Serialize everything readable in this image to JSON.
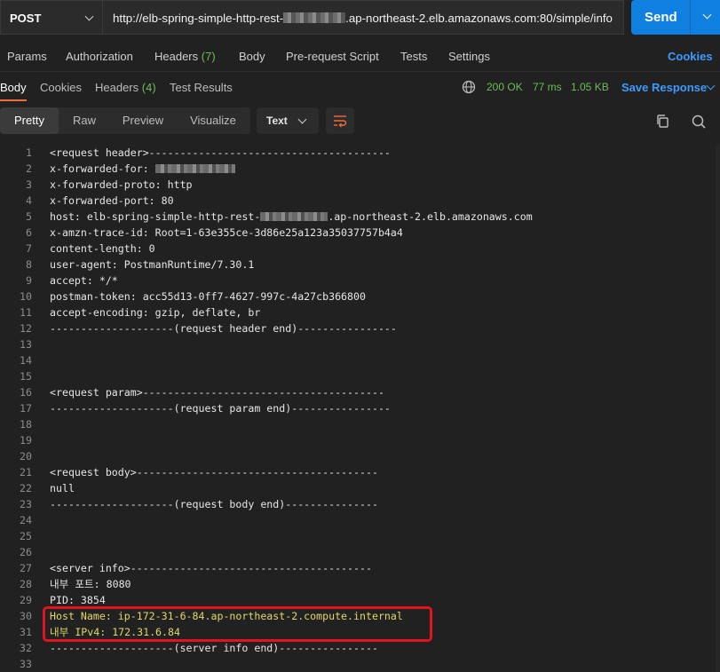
{
  "request": {
    "method": "POST",
    "url_prefix": "http://elb-spring-simple-http-rest-",
    "url_suffix": ".ap-northeast-2.elb.amazonaws.com:80/simple/info",
    "send_label": "Send"
  },
  "request_tabs": [
    {
      "label": "Params"
    },
    {
      "label": "Authorization"
    },
    {
      "label": "Headers",
      "count": "(7)"
    },
    {
      "label": "Body"
    },
    {
      "label": "Pre-request Script"
    },
    {
      "label": "Tests"
    },
    {
      "label": "Settings"
    }
  ],
  "cookies_link": "Cookies",
  "response_tabs": [
    {
      "label": "Body"
    },
    {
      "label": "Cookies"
    },
    {
      "label": "Headers",
      "count": "(4)"
    },
    {
      "label": "Test Results"
    }
  ],
  "status": {
    "code": "200 OK",
    "time": "77 ms",
    "size": "1.05 KB"
  },
  "save_response_label": "Save Response",
  "view_modes": [
    "Pretty",
    "Raw",
    "Preview",
    "Visualize"
  ],
  "active_view": "Pretty",
  "format_label": "Text",
  "code_lines": [
    {
      "n": "1",
      "text": "<request header>---------------------------------------"
    },
    {
      "n": "2",
      "text": "x-forwarded-for: "
    },
    {
      "n": "3",
      "text": "x-forwarded-proto: http"
    },
    {
      "n": "4",
      "text": "x-forwarded-port: 80"
    },
    {
      "n": "5",
      "text": "host: elb-spring-simple-http-rest-",
      "text2": ".ap-northeast-2.elb.amazonaws.com"
    },
    {
      "n": "6",
      "text": "x-amzn-trace-id: Root=1-63e355ce-3d86e25a123a35037757b4a4"
    },
    {
      "n": "7",
      "text": "content-length: 0"
    },
    {
      "n": "8",
      "text": "user-agent: PostmanRuntime/7.30.1"
    },
    {
      "n": "9",
      "text": "accept: */*"
    },
    {
      "n": "10",
      "text": "postman-token: acc55d13-0ff7-4627-997c-4a27cb366800"
    },
    {
      "n": "11",
      "text": "accept-encoding: gzip, deflate, br"
    },
    {
      "n": "12",
      "text": "--------------------(request header end)----------------"
    },
    {
      "n": "13",
      "text": ""
    },
    {
      "n": "14",
      "text": ""
    },
    {
      "n": "15",
      "text": ""
    },
    {
      "n": "16",
      "text": "<request param>---------------------------------------"
    },
    {
      "n": "17",
      "text": "--------------------(request param end)----------------"
    },
    {
      "n": "18",
      "text": ""
    },
    {
      "n": "19",
      "text": ""
    },
    {
      "n": "20",
      "text": ""
    },
    {
      "n": "21",
      "text": "<request body>---------------------------------------"
    },
    {
      "n": "22",
      "text": "null"
    },
    {
      "n": "23",
      "text": "--------------------(request body end)---------------"
    },
    {
      "n": "24",
      "text": ""
    },
    {
      "n": "25",
      "text": ""
    },
    {
      "n": "26",
      "text": ""
    },
    {
      "n": "27",
      "text": "<server info>---------------------------------------"
    },
    {
      "n": "28",
      "text": "내부 포트: 8080"
    },
    {
      "n": "29",
      "text": "PID: 3854"
    },
    {
      "n": "30",
      "text": "Host Name: ip-172-31-6-84.ap-northeast-2.compute.internal",
      "highlight": true
    },
    {
      "n": "31",
      "text": "내부 IPv4: 172.31.6.84",
      "highlight": true
    },
    {
      "n": "32",
      "text": "--------------------(server info end)----------------"
    },
    {
      "n": "33",
      "text": ""
    }
  ],
  "colors": {
    "accent": "#0f7fe0",
    "status_green": "#6dbb5a",
    "link_blue": "#3c9bff",
    "highlight_box": "#e0141e",
    "active_tab_underline": "#f26b3a"
  },
  "icons": [
    "chevron-down-icon",
    "wrap-lines-icon",
    "globe-icon",
    "copy-icon",
    "search-icon"
  ]
}
